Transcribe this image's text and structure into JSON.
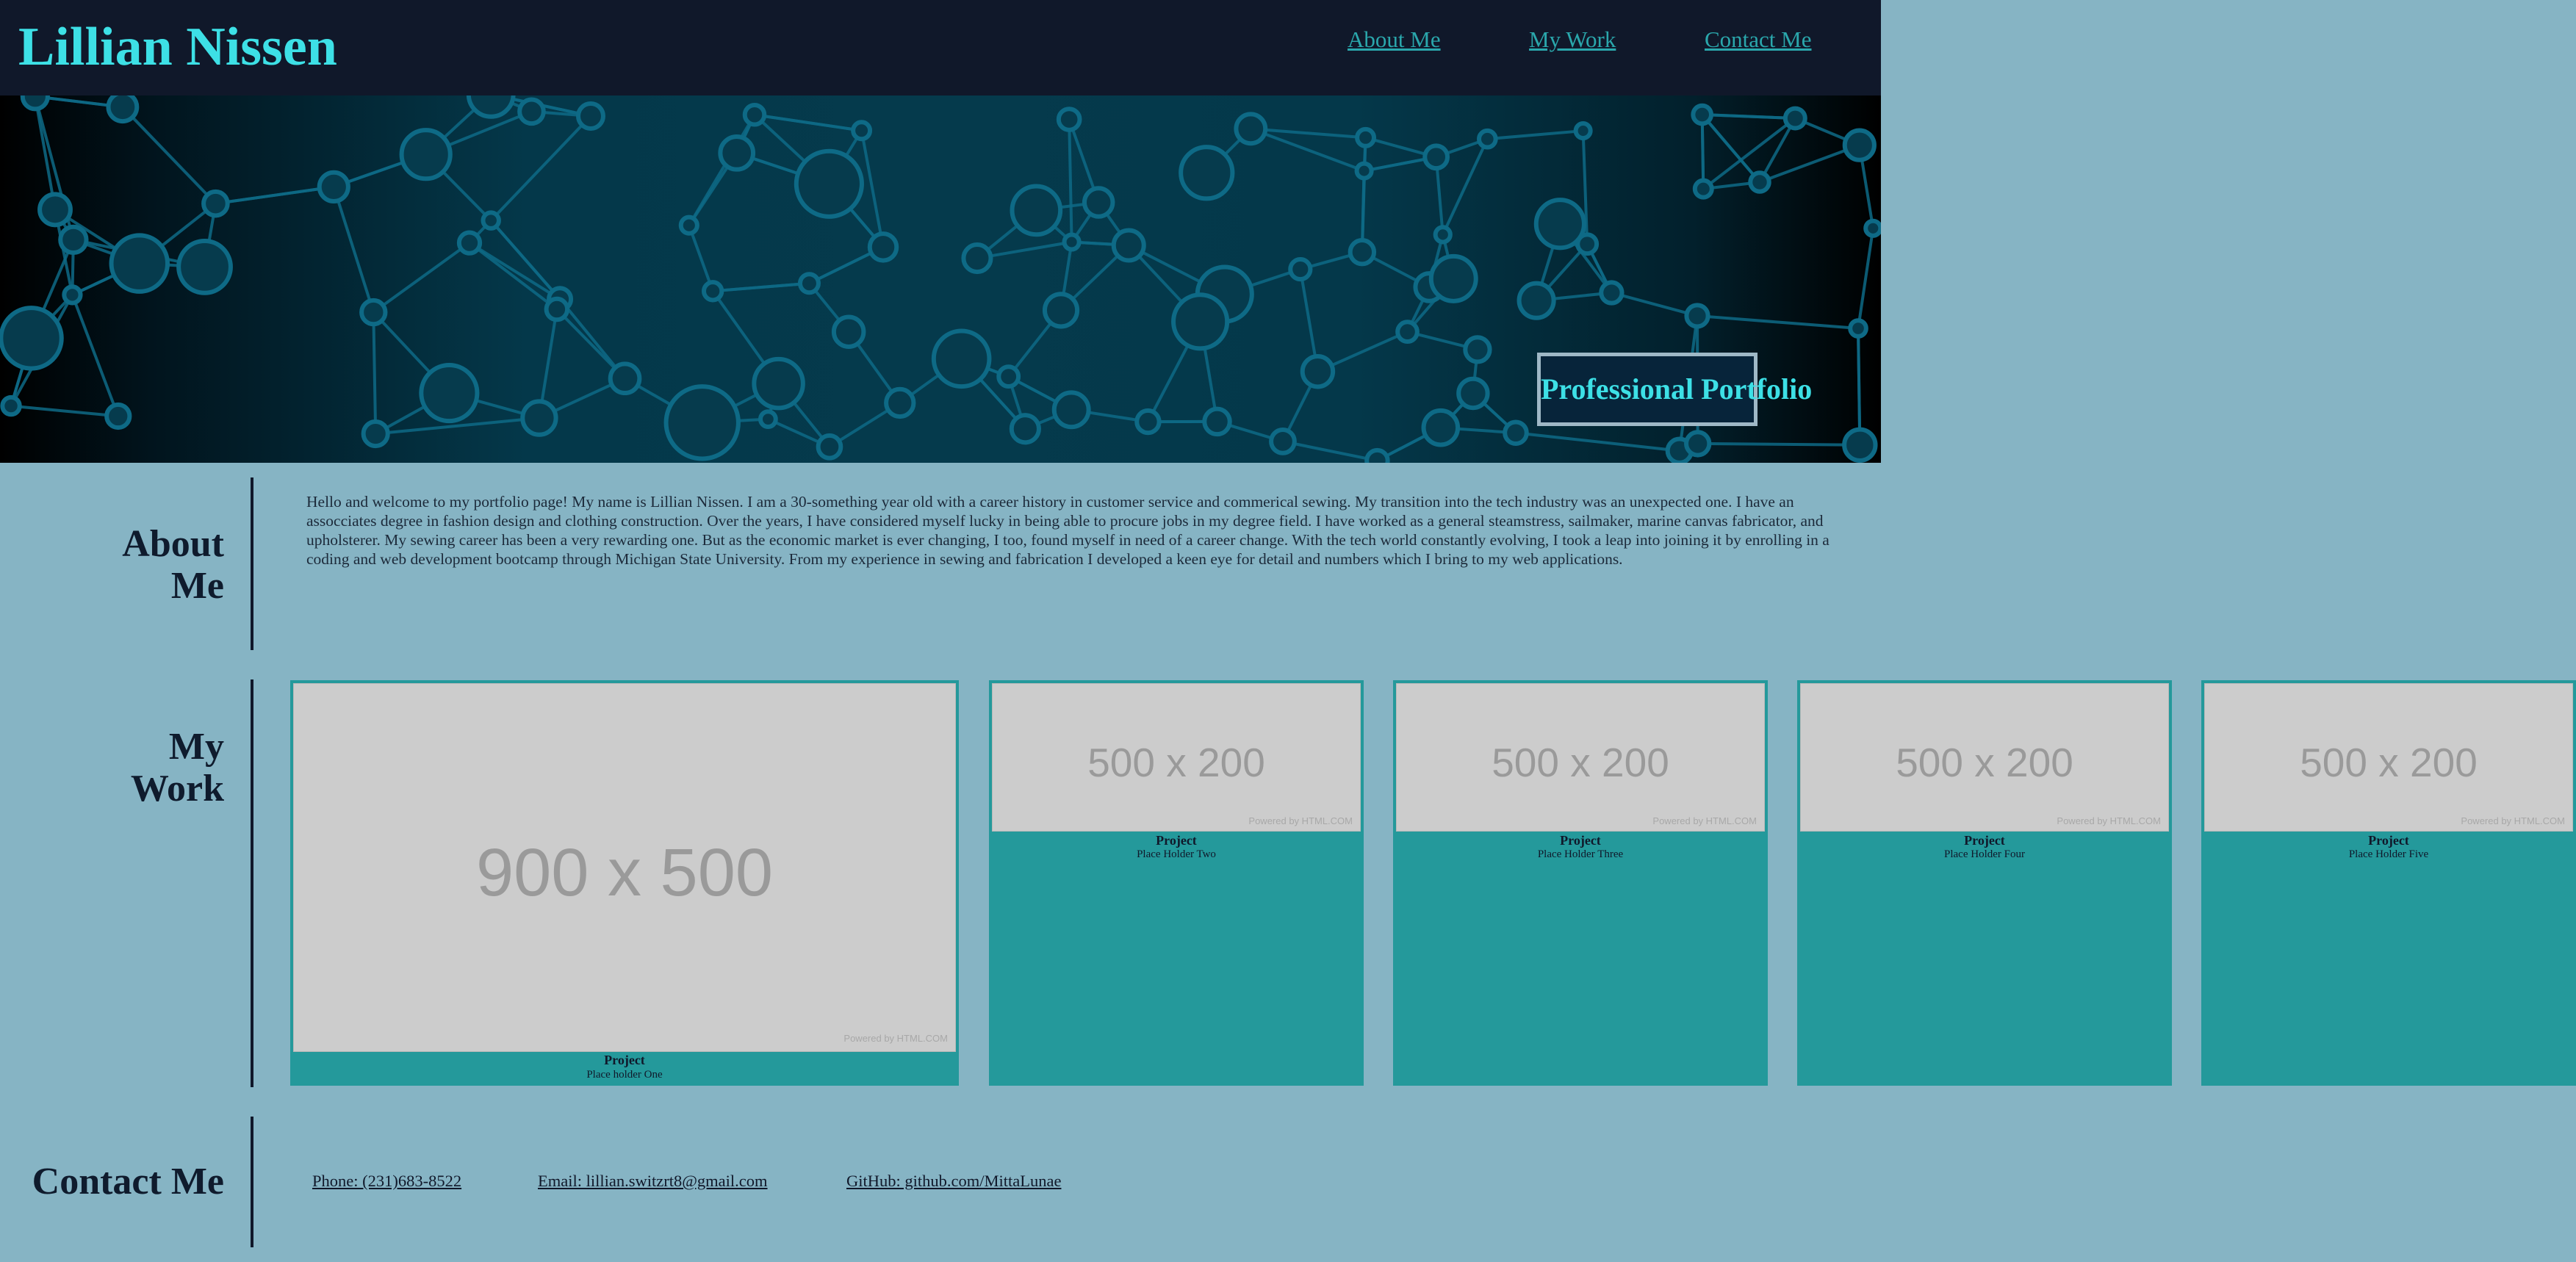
{
  "header": {
    "title": "Lillian Nissen",
    "nav": [
      "About Me",
      "My Work",
      "Contact Me"
    ]
  },
  "hero": {
    "badge": "Professional Portfolio"
  },
  "about": {
    "heading": [
      "About",
      "Me"
    ],
    "text": "Hello and welcome to my portfolio page! My name is Lillian Nissen. I am a 30-something year old with a career history in customer service and commerical sewing. My transition into the tech industry was an unexpected one. I have an assocciates degree in fashion design and clothing construction. Over the years, I have considered myself lucky in being able to procure jobs in my degree field. I have worked as a general steamstress, sailmaker, marine canvas fabricator, and upholsterer. My sewing career has been a very rewarding one. But as the economic market is ever changing, I too, found myself in need of a career change. With the tech world constantly evolving, I took a leap into joining it by enrolling in a coding and web development bootcamp through Michigan State University. From my experience in sewing and fabrication I developed a keen eye for detail and numbers which I bring to my web applications."
  },
  "work": {
    "heading": [
      "My",
      "Work"
    ],
    "projects": [
      {
        "image_label": "900 x 500",
        "powered": "Powered by HTML.COM",
        "title": "Project",
        "subtitle": "Place holder One"
      },
      {
        "image_label": "500 x 200",
        "powered": "Powered by HTML.COM",
        "title": "Project",
        "subtitle": "Place Holder Two"
      },
      {
        "image_label": "500 x 200",
        "powered": "Powered by HTML.COM",
        "title": "Project",
        "subtitle": "Place Holder Three"
      },
      {
        "image_label": "500 x 200",
        "powered": "Powered by HTML.COM",
        "title": "Project",
        "subtitle": "Place Holder Four"
      },
      {
        "image_label": "500 x 200",
        "powered": "Powered by HTML.COM",
        "title": "Project",
        "subtitle": "Place Holder Five"
      }
    ]
  },
  "contact": {
    "heading": "Contact Me",
    "phone": "Phone: (231)683-8522",
    "email": "Email: lillian.switzrt8@gmail.com",
    "github": "GitHub: github.com/MittaLunae"
  },
  "colors": {
    "page_background": "#86b4c4",
    "header_background": "#10182a",
    "accent_cyan": "#3de0e6",
    "card_teal": "#24999b",
    "placeholder_gray": "#cccccc"
  }
}
